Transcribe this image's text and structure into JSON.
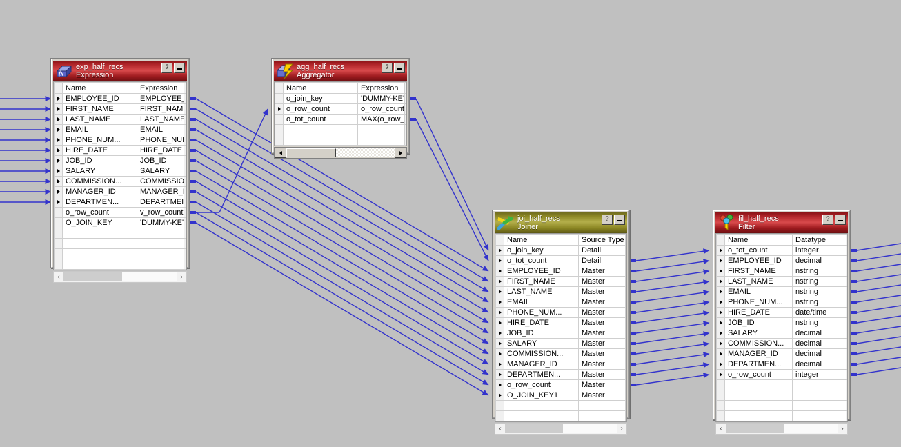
{
  "canvas": {
    "background": "#c0c0c0",
    "link_color": "#3333cc"
  },
  "windows": [
    {
      "id": "exp",
      "name": "exp_half_recs",
      "type": "Expression",
      "icon": "expression-icon",
      "titlebar_color": "#b3282c",
      "help_label": "?",
      "columns": [
        "Name",
        "Expression"
      ],
      "rows": [
        {
          "name": "EMPLOYEE_ID",
          "value": "EMPLOYEE_",
          "in": true,
          "out": true
        },
        {
          "name": "FIRST_NAME",
          "value": "FIRST_NAM",
          "in": true,
          "out": true
        },
        {
          "name": "LAST_NAME",
          "value": "LAST_NAME",
          "in": true,
          "out": true
        },
        {
          "name": "EMAIL",
          "value": "EMAIL",
          "in": true,
          "out": true
        },
        {
          "name": "PHONE_NUM...",
          "value": "PHONE_NUI",
          "in": true,
          "out": true
        },
        {
          "name": "HIRE_DATE",
          "value": "HIRE_DATE",
          "in": true,
          "out": true
        },
        {
          "name": "JOB_ID",
          "value": "JOB_ID",
          "in": true,
          "out": true
        },
        {
          "name": "SALARY",
          "value": "SALARY",
          "in": true,
          "out": true
        },
        {
          "name": "COMMISSION...",
          "value": "COMMISSIO",
          "in": true,
          "out": true
        },
        {
          "name": "MANAGER_ID",
          "value": "MANAGER_I",
          "in": true,
          "out": true
        },
        {
          "name": "DEPARTMEN...",
          "value": "DEPARTMEI",
          "in": true,
          "out": true
        },
        {
          "name": "o_row_count",
          "value": "v_row_count",
          "in": false,
          "out": true
        },
        {
          "name": "O_JOIN_KEY",
          "value": "'DUMMY-KE'",
          "in": false,
          "out": true
        }
      ],
      "empty_rows": 4,
      "scrollbar": {
        "style": "flat",
        "left_arrow": "‹",
        "right_arrow": "›"
      }
    },
    {
      "id": "agg",
      "name": "agg_half_recs",
      "type": "Aggregator",
      "icon": "aggregator-icon",
      "titlebar_color": "#b3282c",
      "help_label": "?",
      "columns": [
        "Name",
        "Expression"
      ],
      "rows": [
        {
          "name": "o_join_key",
          "value": "'DUMMY-KE'",
          "in": false,
          "out": true
        },
        {
          "name": "o_row_count",
          "value": "o_row_count",
          "in": true,
          "out": true
        },
        {
          "name": "o_tot_count",
          "value": "MAX(o_row_",
          "in": false,
          "out": true
        }
      ],
      "empty_rows": 2,
      "scrollbar": {
        "style": "3d",
        "left_arrow": "◀",
        "right_arrow": "▶"
      }
    },
    {
      "id": "joi",
      "name": "joi_half_recs",
      "type": "Joiner",
      "icon": "joiner-icon",
      "titlebar_color": "#8d8826",
      "help_label": "?",
      "columns": [
        "Name",
        "Source Type"
      ],
      "rows": [
        {
          "name": "o_join_key",
          "value": "Detail",
          "in": true,
          "out": true
        },
        {
          "name": "o_tot_count",
          "value": "Detail",
          "in": true,
          "out": true
        },
        {
          "name": "EMPLOYEE_ID",
          "value": "Master",
          "in": true,
          "out": true
        },
        {
          "name": "FIRST_NAME",
          "value": "Master",
          "in": true,
          "out": true
        },
        {
          "name": "LAST_NAME",
          "value": "Master",
          "in": true,
          "out": true
        },
        {
          "name": "EMAIL",
          "value": "Master",
          "in": true,
          "out": true
        },
        {
          "name": "PHONE_NUM...",
          "value": "Master",
          "in": true,
          "out": true
        },
        {
          "name": "HIRE_DATE",
          "value": "Master",
          "in": true,
          "out": true
        },
        {
          "name": "JOB_ID",
          "value": "Master",
          "in": true,
          "out": true
        },
        {
          "name": "SALARY",
          "value": "Master",
          "in": true,
          "out": true
        },
        {
          "name": "COMMISSION...",
          "value": "Master",
          "in": true,
          "out": true
        },
        {
          "name": "MANAGER_ID",
          "value": "Master",
          "in": true,
          "out": true
        },
        {
          "name": "DEPARTMEN...",
          "value": "Master",
          "in": true,
          "out": true
        },
        {
          "name": "o_row_count",
          "value": "Master",
          "in": true,
          "out": true
        },
        {
          "name": "O_JOIN_KEY1",
          "value": "Master",
          "in": true,
          "out": true
        }
      ],
      "empty_rows": 2,
      "scrollbar": {
        "style": "flat",
        "left_arrow": "‹",
        "right_arrow": "›"
      }
    },
    {
      "id": "fil",
      "name": "fil_half_recs",
      "type": "Filter",
      "icon": "filter-icon",
      "titlebar_color": "#b3282c",
      "help_label": "?",
      "columns": [
        "Name",
        "Datatype"
      ],
      "rows": [
        {
          "name": "o_tot_count",
          "value": "integer",
          "in": true,
          "out": true
        },
        {
          "name": "EMPLOYEE_ID",
          "value": "decimal",
          "in": true,
          "out": true
        },
        {
          "name": "FIRST_NAME",
          "value": "nstring",
          "in": true,
          "out": true
        },
        {
          "name": "LAST_NAME",
          "value": "nstring",
          "in": true,
          "out": true
        },
        {
          "name": "EMAIL",
          "value": "nstring",
          "in": true,
          "out": true
        },
        {
          "name": "PHONE_NUM...",
          "value": "nstring",
          "in": true,
          "out": true
        },
        {
          "name": "HIRE_DATE",
          "value": "date/time",
          "in": true,
          "out": true
        },
        {
          "name": "JOB_ID",
          "value": "nstring",
          "in": true,
          "out": true
        },
        {
          "name": "SALARY",
          "value": "decimal",
          "in": true,
          "out": true
        },
        {
          "name": "COMMISSION...",
          "value": "decimal",
          "in": true,
          "out": true
        },
        {
          "name": "MANAGER_ID",
          "value": "decimal",
          "in": true,
          "out": true
        },
        {
          "name": "DEPARTMEN...",
          "value": "decimal",
          "in": true,
          "out": true
        },
        {
          "name": "o_row_count",
          "value": "integer",
          "in": true,
          "out": true
        }
      ],
      "empty_rows": 4,
      "scrollbar": {
        "style": "flat",
        "left_arrow": "‹",
        "right_arrow": "›"
      }
    }
  ]
}
